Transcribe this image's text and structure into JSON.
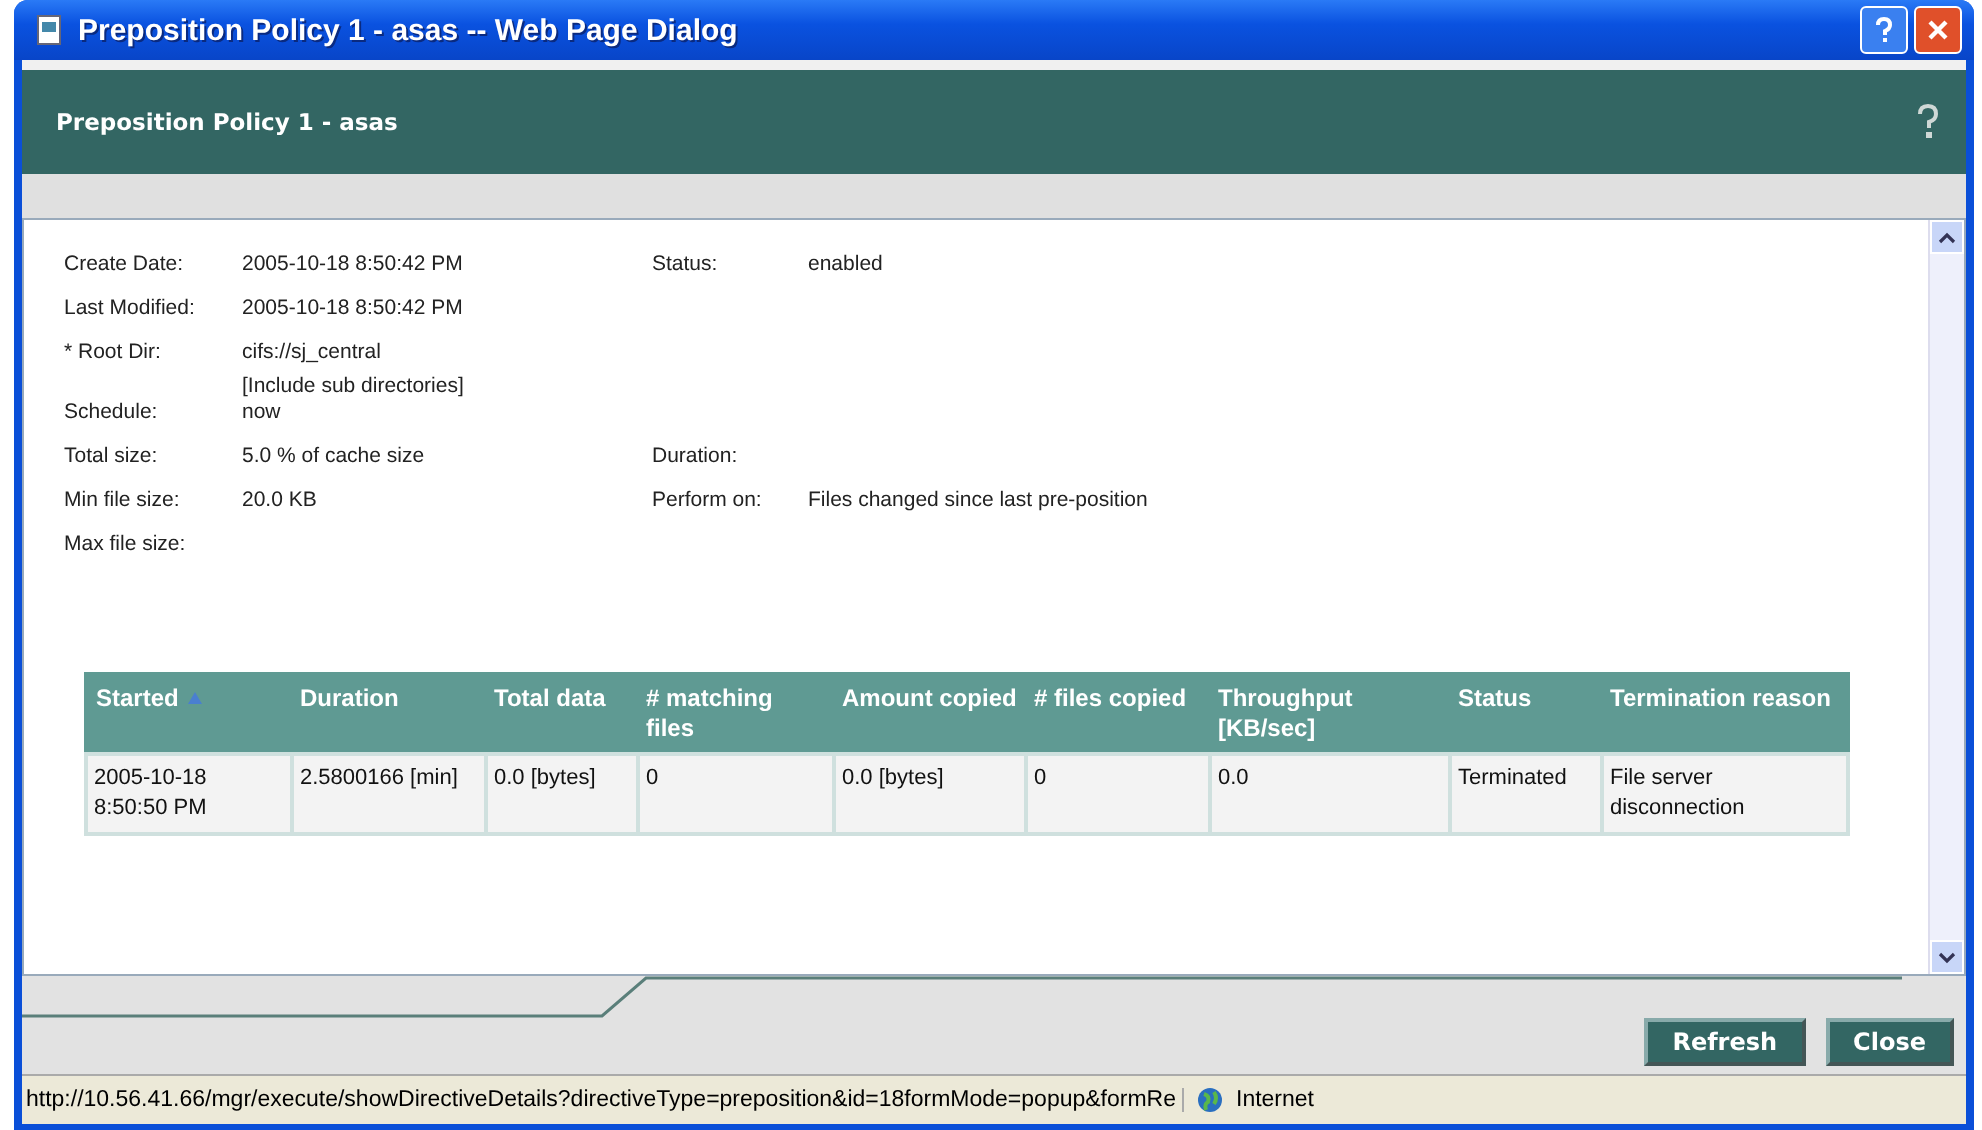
{
  "window": {
    "title": "Preposition Policy 1 - asas -- Web Page Dialog"
  },
  "header": {
    "title": "Preposition Policy 1 - asas"
  },
  "details": [
    {
      "left": {
        "label": "Create Date:",
        "value": [
          "2005-10-18 8:50:42 PM"
        ]
      },
      "right": {
        "label": "Status:",
        "value": [
          "enabled"
        ]
      }
    },
    {
      "left": {
        "label": "Last Modified:",
        "value": [
          "2005-10-18 8:50:42 PM"
        ]
      }
    },
    {
      "left": {
        "label": "* Root Dir:",
        "value": [
          "cifs://sj_central",
          "[Include sub directories]"
        ]
      }
    },
    {
      "left": {
        "label": "Schedule:",
        "value": [
          "now"
        ]
      }
    },
    {
      "left": {
        "label": "Total size:",
        "value": [
          "5.0 % of cache size"
        ]
      },
      "right": {
        "label": "Duration:"
      }
    },
    {
      "left": {
        "label": "Min file size:",
        "value": [
          "20.0 KB"
        ]
      },
      "right": {
        "label": "Perform on:",
        "value": [
          "Files changed since last pre-position"
        ]
      }
    },
    {
      "left": {
        "label": "Max file size:"
      }
    }
  ],
  "table": {
    "columns": [
      {
        "label": "Started",
        "sorted": true
      },
      {
        "label": "Duration",
        "sorted": false
      },
      {
        "label": "Total data",
        "sorted": false
      },
      {
        "label": "# matching files",
        "sorted": false
      },
      {
        "label": "Amount copied",
        "sorted": false
      },
      {
        "label": "# files copied",
        "sorted": false
      },
      {
        "label": "Throughput [KB/sec]",
        "sorted": false
      },
      {
        "label": "Status",
        "sorted": false
      },
      {
        "label": "Termination reason",
        "sorted": false
      }
    ],
    "rows": [
      [
        "2005-10-18 8:50:50 PM",
        "2.5800166 [min]",
        "0.0 [bytes]",
        "0",
        "0.0 [bytes]",
        "0",
        "0.0",
        "Terminated",
        "File server disconnection"
      ]
    ]
  },
  "buttons": [
    "Refresh",
    "Close"
  ],
  "status_bar": {
    "url": "http://10.56.41.66/mgr/execute/showDirectiveDetails?directiveType=preposition&id=18formMode=popup&formRe",
    "zone": "Internet"
  }
}
